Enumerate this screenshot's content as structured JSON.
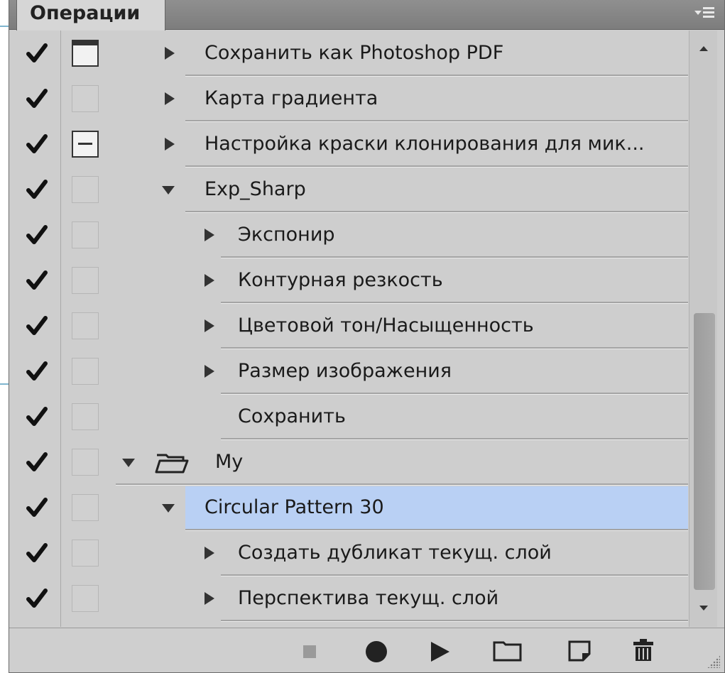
{
  "panel": {
    "tab_label": "Операции"
  },
  "actions": [
    {
      "label": "Сохранить как Photoshop PDF",
      "kind": "collapsed",
      "level": 1,
      "dialog": "on",
      "checked": true
    },
    {
      "label": "Карта градиента",
      "kind": "collapsed",
      "level": 1,
      "dialog": "off",
      "checked": true
    },
    {
      "label": "Настройка краски клонирования для мик...",
      "kind": "collapsed",
      "level": 1,
      "dialog": "mixed",
      "checked": true
    },
    {
      "label": "Exp_Sharp",
      "kind": "expanded",
      "level": 1,
      "dialog": "off",
      "checked": true
    },
    {
      "label": "Экспонир",
      "kind": "collapsed",
      "level": 2,
      "dialog": "off",
      "checked": true
    },
    {
      "label": "Контурная резкость",
      "kind": "collapsed",
      "level": 2,
      "dialog": "off",
      "checked": true
    },
    {
      "label": "Цветовой тон/Насыщенность",
      "kind": "collapsed",
      "level": 2,
      "dialog": "off",
      "checked": true
    },
    {
      "label": "Размер изображения",
      "kind": "collapsed",
      "level": 2,
      "dialog": "off",
      "checked": true
    },
    {
      "label": "Сохранить",
      "kind": "leaf",
      "level": 2,
      "dialog": "off",
      "checked": true
    },
    {
      "label": "My",
      "kind": "set",
      "level": 0,
      "dialog": "off",
      "checked": true
    },
    {
      "label": "Circular Pattern 30",
      "kind": "expanded",
      "level": 1,
      "dialog": "off",
      "checked": true,
      "selected": true
    },
    {
      "label": "Создать дубликат текущ. слой",
      "kind": "collapsed",
      "level": 2,
      "dialog": "off",
      "checked": true
    },
    {
      "label": "Перспектива текущ. слой",
      "kind": "collapsed",
      "level": 2,
      "dialog": "off",
      "checked": true
    }
  ],
  "icons": {
    "check": "checkmark-icon",
    "folder": "folder-icon",
    "stop": "stop-icon",
    "record": "record-icon",
    "play": "play-icon",
    "new_set": "new-set-icon",
    "new_action": "new-action-icon",
    "delete": "trash-icon"
  },
  "colors": {
    "selection": "#b9d0f4",
    "panel_bg": "#cecece"
  }
}
